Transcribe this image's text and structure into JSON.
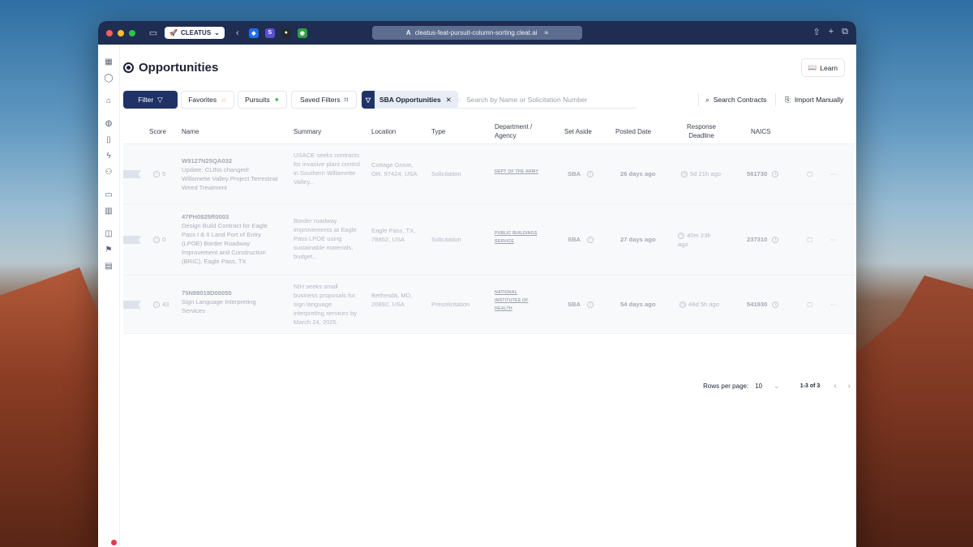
{
  "browser": {
    "tab_label": "CLEATUS",
    "url": "cleatus-feat-pursuit-column-sorting.cleat.ai"
  },
  "page": {
    "title": "Opportunities",
    "learn_label": "Learn"
  },
  "toolbar": {
    "filter_label": "Filter",
    "favorites_label": "Favorites",
    "pursuits_label": "Pursuits",
    "saved_filters_label": "Saved Filters",
    "active_chip_label": "SBA Opportunities",
    "search_placeholder": "Search by Name or Solicitation Number",
    "search_contracts_label": "Search Contracts",
    "import_label": "Import Manually"
  },
  "table": {
    "headers": {
      "score": "Score",
      "name": "Name",
      "summary": "Summary",
      "location": "Location",
      "type": "Type",
      "department_line1": "Department /",
      "department_line2": "Agency",
      "set_aside": "Set Aside",
      "posted": "Posted Date",
      "deadline_line1": "Response",
      "deadline_line2": "Deadline",
      "naics": "NAICS"
    },
    "rows": [
      {
        "score": "5",
        "solicitation": "W9127N25QA032",
        "name": "Update, CLINs changed! Willamette Valley Project Terrestrial Weed Treatment",
        "summary": "USACE seeks contracts for invasive plant control in Southern Willamette Valley...",
        "location": "Cottage Grove, OR, 97424, USA",
        "type": "Solicitation",
        "agency": "DEPT OF THE ARMY",
        "set_aside": "SBA",
        "posted": "26 days ago",
        "deadline": "5d 21h ago",
        "naics": "561730"
      },
      {
        "score": "0",
        "solicitation": "47PH0825R0003",
        "name": "Design Build Contract for Eagle Pass I & II Land Port of Entry (LPOE) Border Roadway Improvement and Construction (BRIC), Eagle Pass, TX",
        "summary": "Border roadway improvements at Eagle Pass LPOE using sustainable materials, budget...",
        "location": "Eagle Pass, TX, 78852, USA",
        "type": "Solicitation",
        "agency": "PUBLIC BUILDINGS SERVICE",
        "set_aside": "SBA",
        "posted": "27 days ago",
        "deadline": "40m 23h ago",
        "naics": "237310"
      },
      {
        "score": "43",
        "solicitation": "75N98019D00055",
        "name": "Sign Language Interpreting Services",
        "summary": "NIH seeks small business proposals for sign language interpreting services by March 24, 2025.",
        "location": "Bethesda, MD, 20892, USA",
        "type": "Presolicitation",
        "agency": "NATIONAL INSTITUTES OF HEALTH",
        "set_aside": "SBA",
        "posted": "54 days ago",
        "deadline": "48d 5h ago",
        "naics": "541930"
      }
    ]
  },
  "pagination": {
    "rows_per_page_label": "Rows per page:",
    "rows_per_page_value": "10",
    "range": "1-3 of 3"
  }
}
